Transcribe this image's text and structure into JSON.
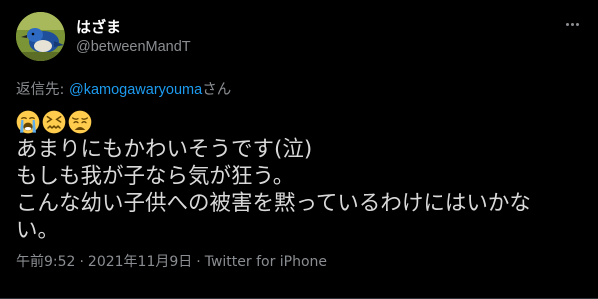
{
  "author": {
    "display_name": "はざま",
    "handle": "@betweenMandT"
  },
  "reply": {
    "prefix": "返信先: ",
    "mention": "@kamogawaryouma",
    "suffix": "さん"
  },
  "emojis": [
    "loudly-crying-face",
    "confounded-face",
    "weary-face"
  ],
  "body": {
    "lines": [
      "あまりにもかわいそうです(泣)",
      "もしも我が子なら気が狂う。",
      "こんな幼い子供への被害を黙っているわけにはいかな",
      "い。"
    ]
  },
  "meta": {
    "time": "午前9:52",
    "separator": "·",
    "date": "2021年11月9日",
    "client": "Twitter for iPhone"
  },
  "colors": {
    "background": "#000000",
    "text": "#d9d9d9",
    "muted": "#8a8d91",
    "link": "#1d9bf0"
  }
}
